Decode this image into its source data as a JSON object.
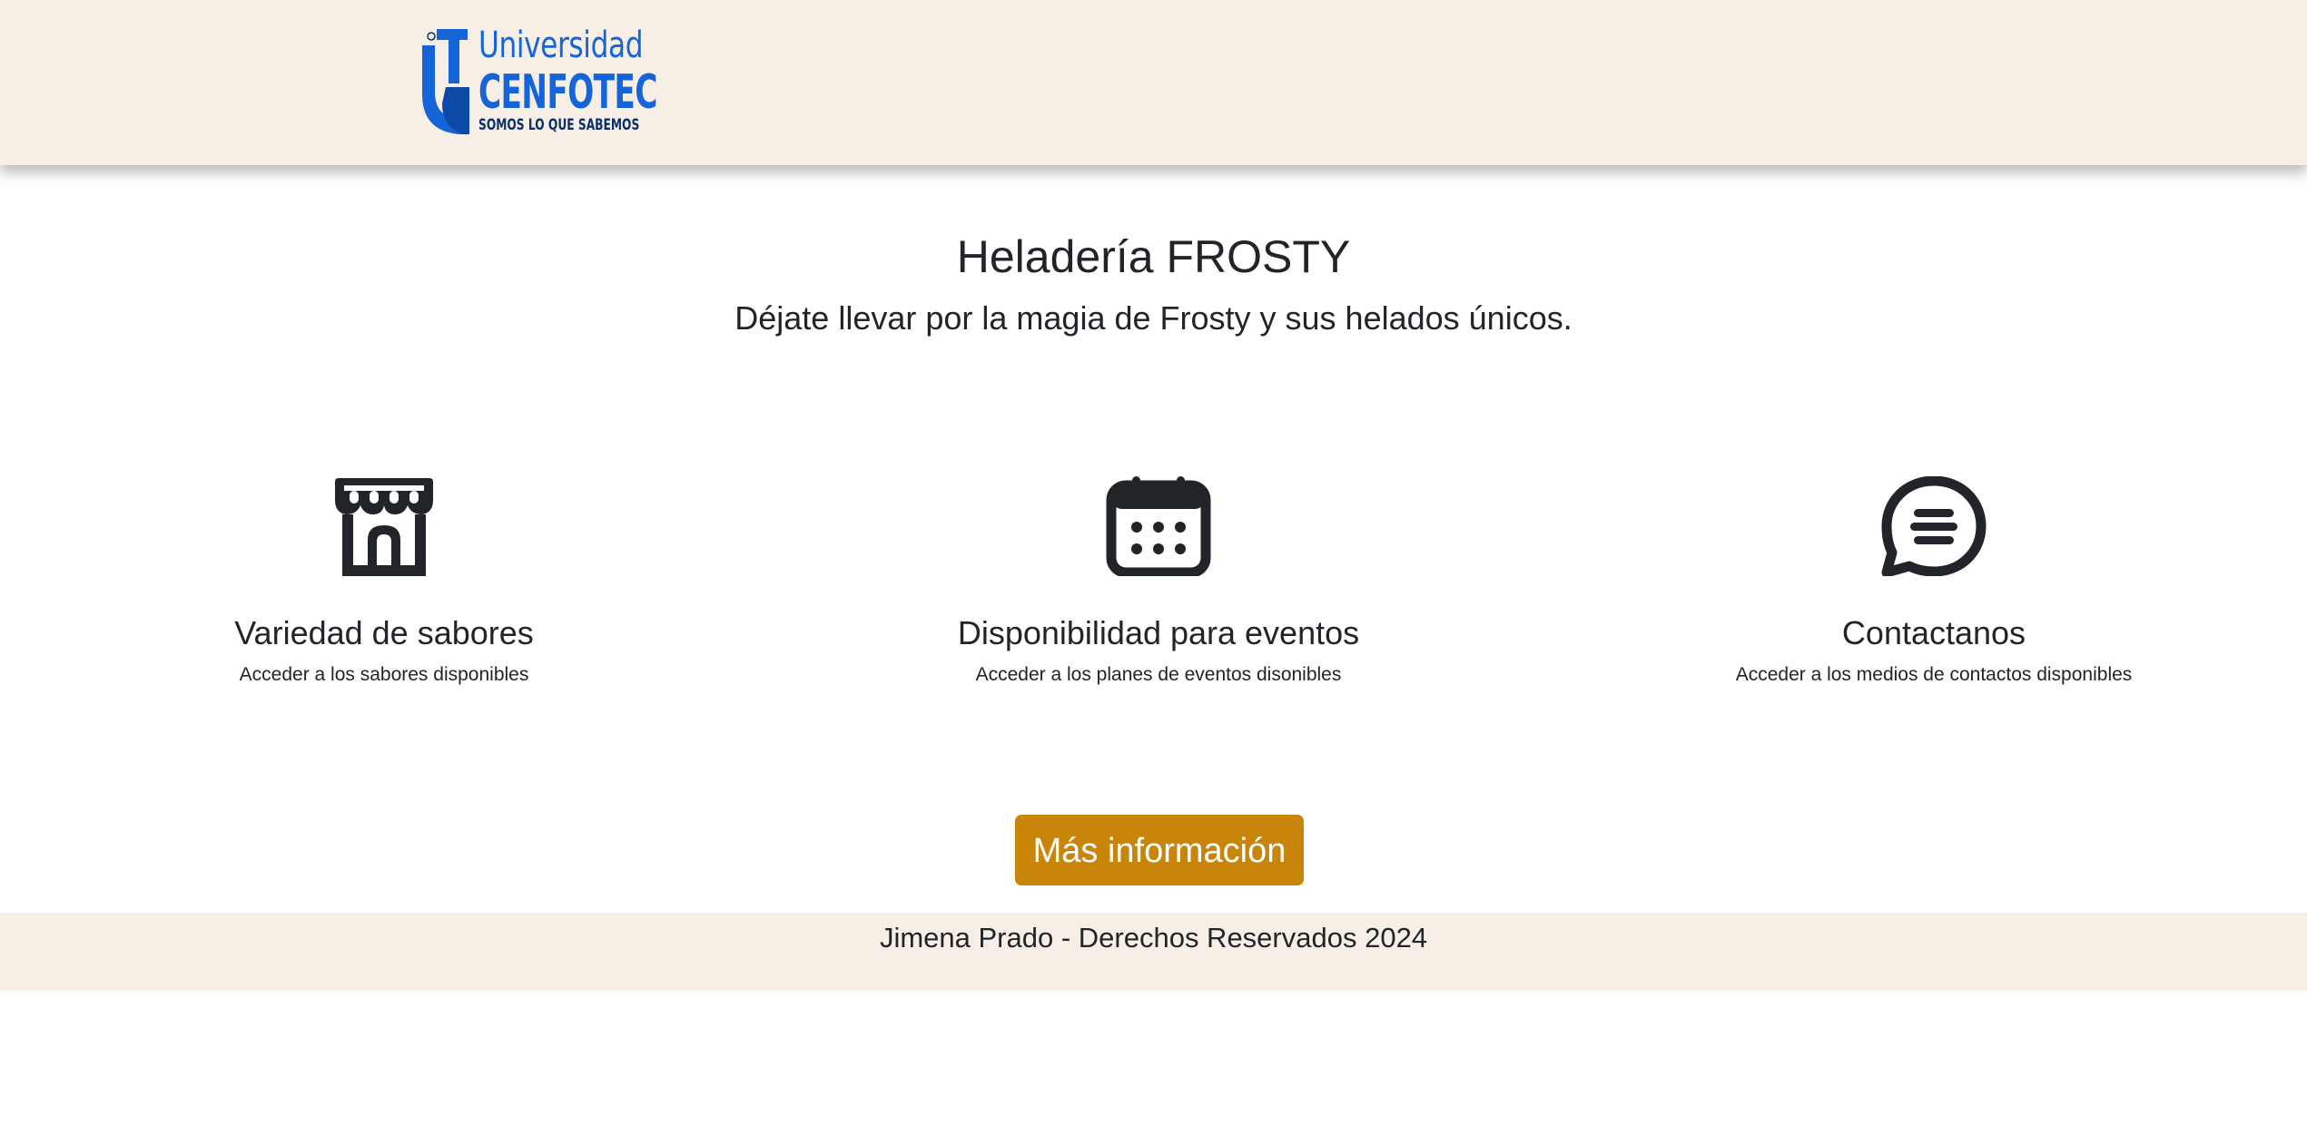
{
  "header": {
    "logo": {
      "line1": "Universidad",
      "line2": "CENFOTEC",
      "line3": "SOMOS LO QUE SABEMOS",
      "brand_color": "#1565d8",
      "dark_color": "#0a2f6b"
    },
    "background": "#f7efe5"
  },
  "hero": {
    "title": "Heladería FROSTY",
    "subtitle": "Déjate llevar por la magia de Frosty y sus helados únicos."
  },
  "features": [
    {
      "icon": "shop-icon",
      "title": "Variedad de sabores",
      "description": "Acceder a los sabores disponibles"
    },
    {
      "icon": "calendar-icon",
      "title": "Disponibilidad para eventos",
      "description": "Acceder a los planes de eventos disonibles"
    },
    {
      "icon": "chat-icon",
      "title": "Contactanos",
      "description": "Acceder a los medios de contactos disponibles"
    }
  ],
  "cta": {
    "label": "Más información",
    "color": "#c8850a"
  },
  "footer": {
    "text": "Jimena Prado - Derechos Reservados 2024"
  }
}
